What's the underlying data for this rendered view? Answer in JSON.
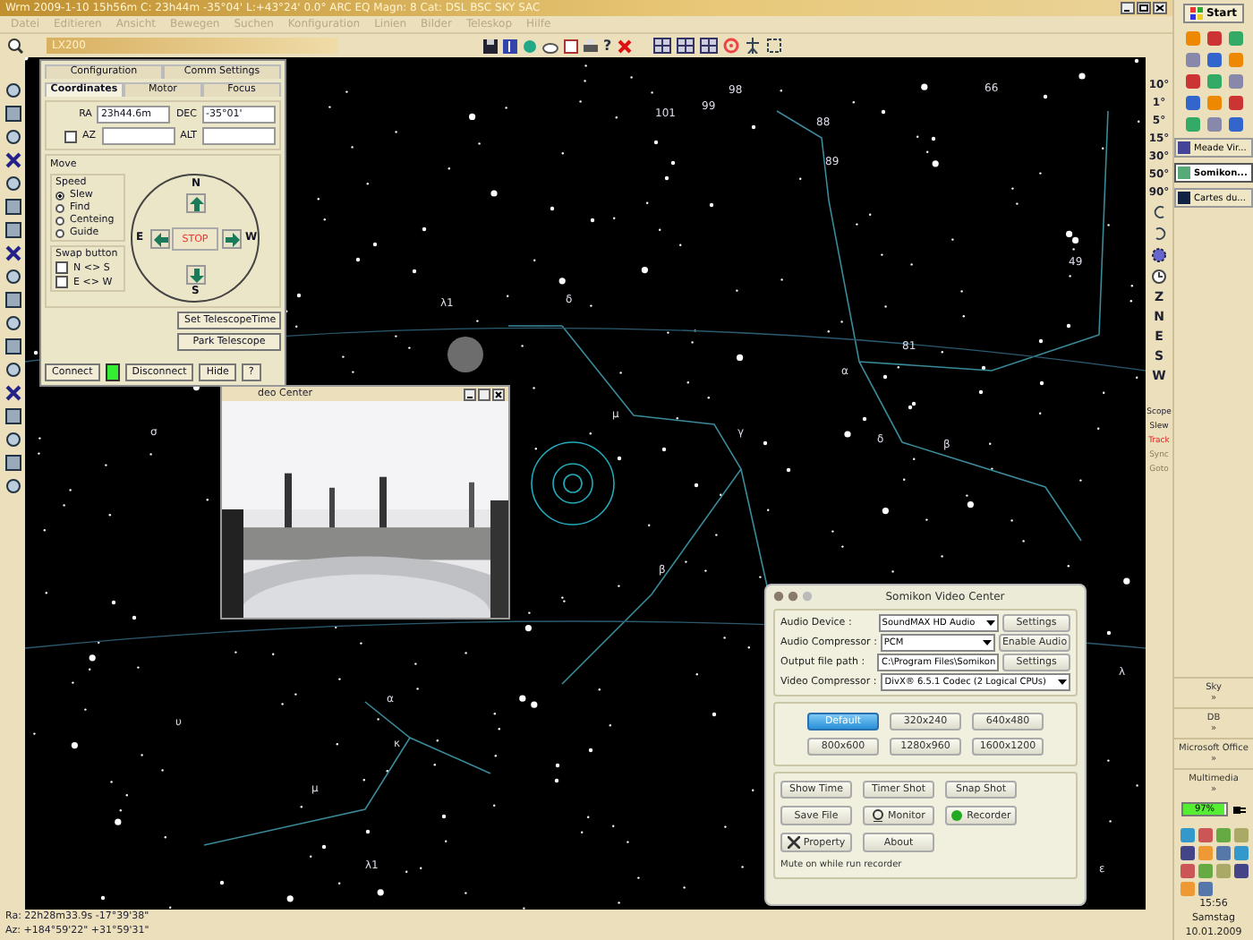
{
  "window": {
    "title": "Wrm 2009-1-10  15h56m C: 23h44m -35°04' L:+43°24' 0.0° ARC EQ Magn: 8 Cat: DSL BSC SKY SAC",
    "menu": [
      "Datei",
      "Editieren",
      "Ansicht",
      "Bewegen",
      "Suchen",
      "Konfiguration",
      "Linien",
      "Bilder",
      "Teleskop",
      "Hilfe"
    ]
  },
  "toolbar": {
    "telescope_select": "LX200",
    "help": "?"
  },
  "chart_tools": {
    "fields": [
      "10°",
      "1°",
      "5°",
      "15°",
      "30°",
      "50°",
      "90°"
    ],
    "directions": [
      "Z",
      "N",
      "E",
      "S",
      "W"
    ],
    "scope_buttons": [
      {
        "label": "Scope",
        "disabled": false,
        "active": false
      },
      {
        "label": "Slew",
        "disabled": false,
        "active": false
      },
      {
        "label": "Track",
        "disabled": false,
        "active": true
      },
      {
        "label": "Sync",
        "disabled": true,
        "active": false
      },
      {
        "label": "Goto",
        "disabled": true,
        "active": false
      }
    ]
  },
  "star_labels": [
    "98",
    "66",
    "101",
    "99",
    "88",
    "89",
    "49",
    "λ1",
    "δ",
    "81",
    "α",
    "μ",
    "σ",
    "γ",
    "δ",
    "β",
    "β",
    "λ",
    "α",
    "υ",
    "κ",
    "μ",
    "λ1",
    "ε"
  ],
  "telescope_panel": {
    "tabs": [
      {
        "label": "Configuration",
        "selected": false
      },
      {
        "label": "Comm Settings",
        "selected": false
      },
      {
        "label": "Coordinates",
        "selected": true
      },
      {
        "label": "Motor",
        "selected": false
      },
      {
        "label": "Focus",
        "selected": false
      }
    ],
    "ra_label": "RA",
    "ra": "23h44.6m",
    "dec_label": "DEC",
    "dec": "-35°01'",
    "az_label": "AZ",
    "az_checked": false,
    "alt_label": "ALT",
    "move_label": "Move",
    "speed_label": "Speed",
    "speeds": [
      {
        "label": "Slew",
        "selected": true
      },
      {
        "label": "Find",
        "selected": false
      },
      {
        "label": "Centeing",
        "selected": false
      },
      {
        "label": "Guide",
        "selected": false
      }
    ],
    "swap_label": "Swap button",
    "swaps": [
      {
        "label": "N <> S",
        "checked": false
      },
      {
        "label": "E <> W",
        "checked": false
      }
    ],
    "north": "N",
    "south": "S",
    "east": "E",
    "west": "W",
    "stop": "STOP",
    "buttons": [
      "Set TelescopeTime",
      "Park Telescope"
    ],
    "connect": "Connect",
    "connected": true,
    "disconnect": "Disconnect",
    "hide": "Hide",
    "help": "?"
  },
  "video_window": {
    "title": "deo Center"
  },
  "video_center": {
    "title": "Somikon Video Center",
    "fields": [
      {
        "label": "Audio Device :",
        "value": "SoundMAX HD Audio",
        "kind": "select",
        "button": "Settings"
      },
      {
        "label": "Audio Compressor :",
        "value": "PCM",
        "kind": "select",
        "button": "Enable Audio"
      },
      {
        "label": "Output file path :",
        "value": "C:\\Program Files\\Somikon",
        "kind": "text",
        "button": "Settings"
      },
      {
        "label": "Video Compressor :",
        "value": "DivX® 6.5.1 Codec (2 Logical CPUs)",
        "kind": "select"
      }
    ],
    "resolutions": [
      {
        "label": "Default",
        "selected": true
      },
      {
        "label": "320x240",
        "selected": false
      },
      {
        "label": "640x480",
        "selected": false
      },
      {
        "label": "800x600",
        "selected": false
      },
      {
        "label": "1280x960",
        "selected": false
      },
      {
        "label": "1600x1200",
        "selected": false
      }
    ],
    "actions": [
      "Show Time",
      "Timer Shot",
      "Snap Shot",
      "Save File",
      "Monitor",
      "Recorder",
      "Property",
      "About"
    ],
    "note": "Mute on while run recorder"
  },
  "taskbar": {
    "start": "Start",
    "tasks": [
      {
        "label": "Meade Vir...",
        "selected": false
      },
      {
        "label": "Somikon...",
        "selected": true
      },
      {
        "label": "Cartes du...",
        "selected": false
      }
    ],
    "groups": [
      {
        "name": "Sky",
        "more": "»"
      },
      {
        "name": "DB",
        "more": "»"
      },
      {
        "name": "Microsoft Office",
        "more": "»"
      },
      {
        "name": "Multimedia",
        "more": "»"
      }
    ],
    "battery": {
      "level": 0.97,
      "reading": "97%"
    },
    "clock": {
      "time": "15:56",
      "day": "Samstag",
      "date": "10.01.2009"
    }
  },
  "status_bar": [
    "Ra: 22h28m33.9s -17°39'38\"",
    "Az: +184°59'22\" +31°59'31\""
  ]
}
